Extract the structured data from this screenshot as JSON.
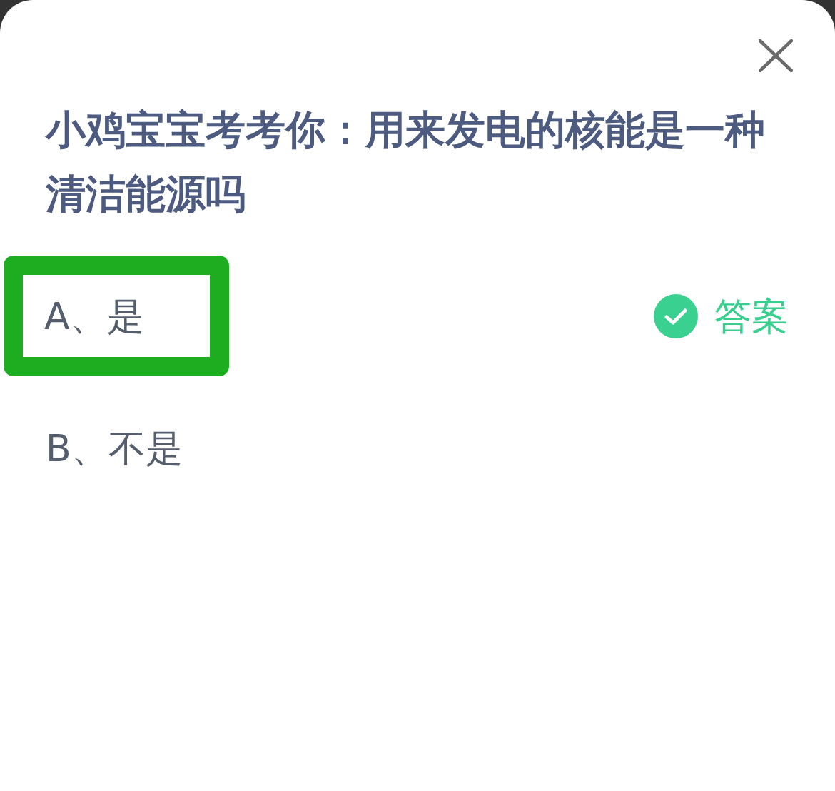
{
  "question": {
    "title": "小鸡宝宝考考你：用来发电的核能是一种清洁能源吗"
  },
  "answer_label": "答案",
  "options": [
    {
      "text": "A、是",
      "highlighted": true,
      "correct": true
    },
    {
      "text": "B、不是",
      "highlighted": false,
      "correct": false
    }
  ]
}
